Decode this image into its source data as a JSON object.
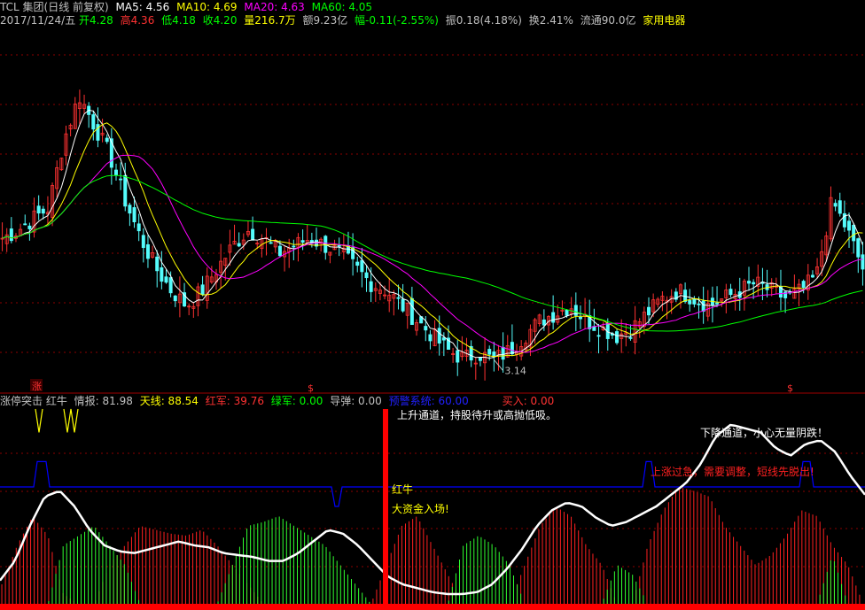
{
  "header": {
    "line1": {
      "title": "TCL 集团(日线 前复权)",
      "ma5": "MA5: 4.56",
      "ma10": "MA10: 4.69",
      "ma20": "MA20: 4.63",
      "ma60": "MA60: 4.05"
    },
    "line2": {
      "date": "2017/11/24/五",
      "open": "开4.28",
      "high": "高4.36",
      "low": "低4.18",
      "close": "收4.20",
      "volume": "量216.7万",
      "amount": "额9.23亿",
      "change": "幅-0.11(-2.55%)",
      "amplitude": "振0.18(4.18%)",
      "turnover": "换2.41%",
      "float_value": "流通90.0亿",
      "sector": "家用电器"
    }
  },
  "indicator_header": {
    "name": "涨停突击 红牛",
    "qingbao": "情报: 81.98",
    "tianxian": "天线: 88.54",
    "hongjun": "红军: 39.76",
    "lvjun": "绿军: 0.00",
    "daodan": "导弹: 0.00",
    "yujing": "预警系统: 60.00",
    "mairu": "买入: 0.00"
  },
  "annotations": {
    "low_price": "3.14",
    "zhang_marker": "涨",
    "dollar_marker": "$",
    "hongniu": "红牛",
    "dazijin": "大资金入场!",
    "xiajiang": "下降通道，小心无量阴跌！",
    "shangzhang": "上涨过急，需要调整，短线先脱出!",
    "shangsheng": "上升通道，持股待升或高抛低吸。"
  },
  "colors": {
    "background": "#000000",
    "up_candle": "#ff3232",
    "down_candle": "#54fcfc",
    "ma5": "#ffffff",
    "ma10": "#ffff00",
    "ma20": "#ff00ff",
    "ma60": "#00ff00",
    "grid": "#8b0000",
    "red_bar": "#ff2020",
    "green_bar": "#30ff30",
    "white_line": "#ffffff",
    "blue_line": "#0000ff",
    "yellow_line": "#ffff00",
    "signal_bar": "#ff0000"
  },
  "chart_data": [
    {
      "type": "candlestick",
      "title": "TCL 集团(日线 前复权)",
      "series": [
        {
          "name": "MA5",
          "value": 4.56
        },
        {
          "name": "MA10",
          "value": 4.69
        },
        {
          "name": "MA20",
          "value": 4.63
        },
        {
          "name": "MA60",
          "value": 4.05
        }
      ],
      "close_path": [
        3.95,
        4.0,
        4.08,
        4.15,
        4.6,
        4.9,
        4.7,
        4.5,
        4.2,
        3.95,
        3.75,
        3.6,
        3.5,
        3.6,
        3.75,
        3.9,
        4.0,
        3.95,
        3.85,
        3.9,
        3.95,
        3.9,
        3.85,
        3.75,
        3.65,
        3.6,
        3.5,
        3.4,
        3.3,
        3.2,
        3.15,
        3.18,
        3.14,
        3.2,
        3.3,
        3.4,
        3.45,
        3.5,
        3.4,
        3.35,
        3.3,
        3.35,
        3.45,
        3.55,
        3.6,
        3.55,
        3.5,
        3.55,
        3.6,
        3.65,
        3.6,
        3.55,
        3.6,
        3.7,
        4.2,
        4.0,
        3.75
      ],
      "low_label": 3.14,
      "ylim": [
        3.0,
        5.3
      ]
    },
    {
      "type": "indicator",
      "title": "涨停突击 红牛",
      "series": [
        {
          "name": "情报",
          "value": 81.98
        },
        {
          "name": "天线",
          "value": 88.54
        },
        {
          "name": "红军",
          "value": 39.76
        },
        {
          "name": "绿军",
          "value": 0.0
        },
        {
          "name": "导弹",
          "value": 0.0
        },
        {
          "name": "预警系统",
          "value": 60.0
        },
        {
          "name": "买入",
          "value": 0.0
        }
      ],
      "white_path": [
        12,
        22,
        40,
        55,
        58,
        50,
        38,
        30,
        27,
        26,
        28,
        30,
        32,
        30,
        29,
        26,
        25,
        24,
        22,
        22,
        26,
        32,
        38,
        36,
        30,
        22,
        14,
        10,
        8,
        6,
        5,
        5,
        6,
        10,
        18,
        28,
        40,
        48,
        52,
        50,
        44,
        40,
        42,
        46,
        50,
        56,
        62,
        72,
        86,
        92,
        90,
        88,
        80,
        76,
        82,
        84,
        78,
        66,
        56
      ],
      "red_path": [
        10,
        30,
        45,
        35,
        5,
        0,
        0,
        20,
        30,
        40,
        38,
        36,
        35,
        38,
        30,
        20,
        10,
        0,
        0,
        0,
        0,
        0,
        0,
        0,
        0,
        20,
        40,
        45,
        30,
        15,
        0,
        0,
        0,
        0,
        20,
        40,
        50,
        45,
        30,
        20,
        0,
        0,
        30,
        48,
        60,
        58,
        55,
        40,
        30,
        20,
        25,
        35,
        48,
        45,
        30,
        20,
        0
      ],
      "green_path": [
        0,
        0,
        0,
        0,
        30,
        35,
        40,
        30,
        20,
        0,
        0,
        0,
        0,
        0,
        0,
        20,
        40,
        42,
        45,
        40,
        35,
        30,
        20,
        10,
        0,
        0,
        0,
        0,
        0,
        0,
        30,
        35,
        30,
        20,
        0,
        0,
        0,
        0,
        0,
        0,
        20,
        15,
        0,
        0,
        0,
        0,
        0,
        0,
        0,
        0,
        0,
        0,
        0,
        0,
        25,
        0,
        0
      ],
      "ylim": [
        0,
        100
      ]
    }
  ]
}
